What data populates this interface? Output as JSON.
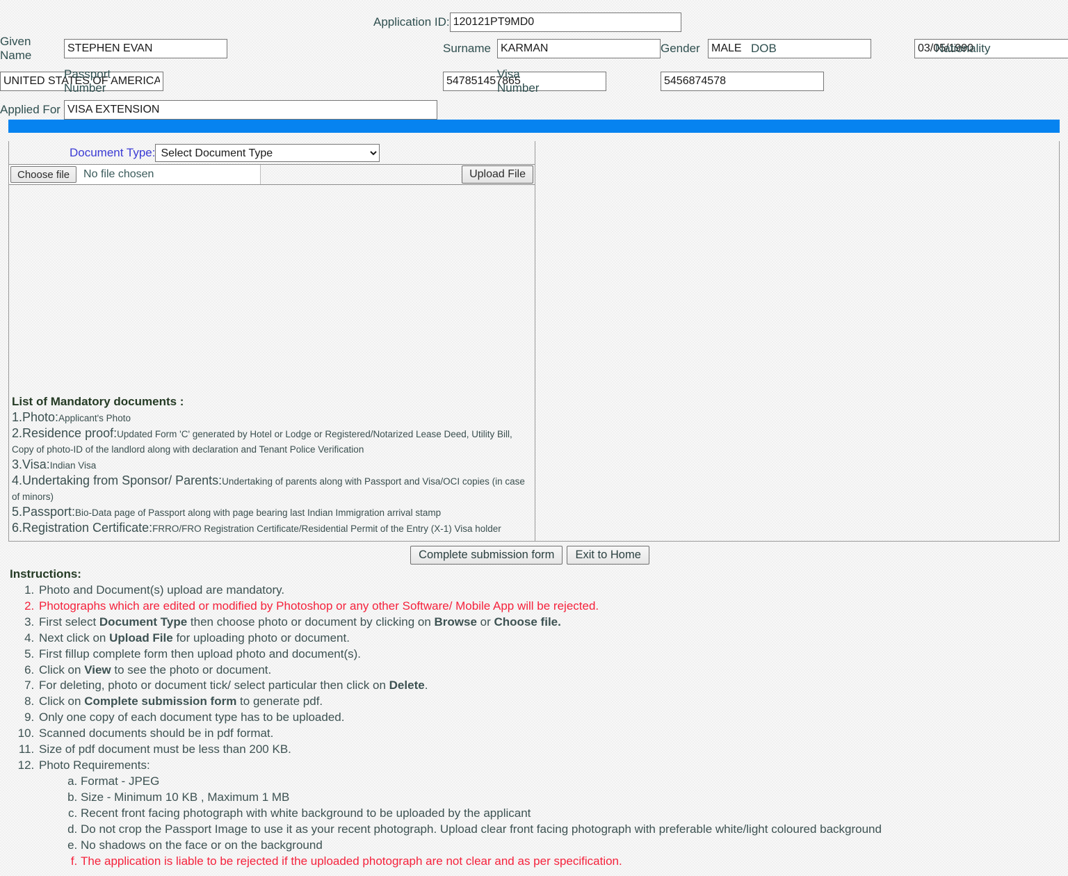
{
  "header": {
    "application_id_label": "Application ID:",
    "application_id_value": "120121PT9MD0",
    "given_name_label": "Given Name",
    "given_name_value": "STEPHEN EVAN",
    "surname_label": "Surname",
    "surname_value": "KARMAN",
    "gender_label": "Gender",
    "gender_value": "MALE",
    "dob_label": "DOB",
    "dob_value": "03/05/1990",
    "nationality_label": "Nationality",
    "nationality_value": "UNITED STATES OF AMERICA",
    "passport_number_label": "Passport Number",
    "passport_number_value": "547851457865",
    "visa_number_label": "Visa Number",
    "visa_number_value": "5456874578",
    "applied_for_label": "Applied For",
    "applied_for_value": "VISA EXTENSION"
  },
  "upload": {
    "document_type_label": "Document Type:",
    "document_type_selected": "Select Document Type",
    "document_type_options": [
      "Select Document Type"
    ],
    "choose_file_label": "Choose file",
    "file_status": "No file chosen",
    "upload_button_label": "Upload File"
  },
  "mandatory": {
    "title": "List of Mandatory documents :",
    "items": [
      {
        "num": "1.",
        "name": "Photo:",
        "desc": "Applicant's Photo"
      },
      {
        "num": "2.",
        "name": "Residence proof:",
        "desc": "Updated Form 'C' generated by Hotel or Lodge or Registered/Notarized Lease Deed, Utility Bill, Copy of photo-ID of the landlord along with declaration and Tenant Police Verification"
      },
      {
        "num": "3.",
        "name": "Visa:",
        "desc": "Indian Visa"
      },
      {
        "num": "4.",
        "name": "Undertaking from Sponsor/ Parents:",
        "desc": "Undertaking of parents along with Passport and Visa/OCI copies (in case of minors)"
      },
      {
        "num": "5.",
        "name": "Passport:",
        "desc": "Bio-Data page of Passport along with page bearing last Indian Immigration arrival stamp"
      },
      {
        "num": "6.",
        "name": "Registration Certificate:",
        "desc": "FRRO/FRO Registration Certificate/Residential Permit of the Entry (X-1) Visa holder"
      }
    ]
  },
  "actions": {
    "complete_label": "Complete submission form",
    "exit_label": "Exit to Home"
  },
  "instructions": {
    "title": "Instructions:",
    "items": [
      {
        "text": "Photo and Document(s) upload are mandatory.",
        "red": false
      },
      {
        "text": "Photographs which are edited or modified by Photoshop or any other Software/ Mobile App will be rejected.",
        "red": true
      },
      {
        "text": "First select <b>Document Type</b> then choose photo or document by clicking on <b>Browse</b> or <b>Choose file.</b>",
        "red": false,
        "html": true
      },
      {
        "text": "Next click on <b>Upload File</b> for uploading photo or document.",
        "red": false,
        "html": true
      },
      {
        "text": "First fillup complete form then upload photo and document(s).",
        "red": false
      },
      {
        "text": "Click on <b>View</b> to see the photo or document.",
        "red": false,
        "html": true
      },
      {
        "text": "For deleting, photo or document tick/ select particular then click on <b>Delete</b>.",
        "red": false,
        "html": true
      },
      {
        "text": "Click on <b>Complete submission form</b> to generate pdf.",
        "red": false,
        "html": true
      },
      {
        "text": "Only one copy of each document type has to be uploaded.",
        "red": false
      },
      {
        "text": "Scanned documents should be in pdf format.",
        "red": false
      },
      {
        "text": "Size of pdf document must be less than 200 KB.",
        "red": false
      },
      {
        "text": "Photo Requirements:",
        "red": false
      }
    ],
    "photo_requirements": [
      {
        "text": "Format - JPEG",
        "red": false
      },
      {
        "text": "Size - Minimum 10 KB , Maximum 1 MB",
        "red": false
      },
      {
        "text": "Recent front facing photograph with white background to be uploaded by the applicant",
        "red": false
      },
      {
        "text": "Do not crop the Passport Image to use it as your recent photograph. Upload clear front facing photograph with preferable white/light coloured background",
        "red": false
      },
      {
        "text": "No shadows on the face or on the background",
        "red": false
      },
      {
        "text": "The application is liable to be rejected if the uploaded photograph are not clear and as per specification.",
        "red": true
      }
    ]
  },
  "colors": {
    "accent_blue_bar": "#0683f0",
    "label_link_blue": "#3b3bd4",
    "warning_red": "#f5223c",
    "page_background": "#f0f0f0"
  }
}
